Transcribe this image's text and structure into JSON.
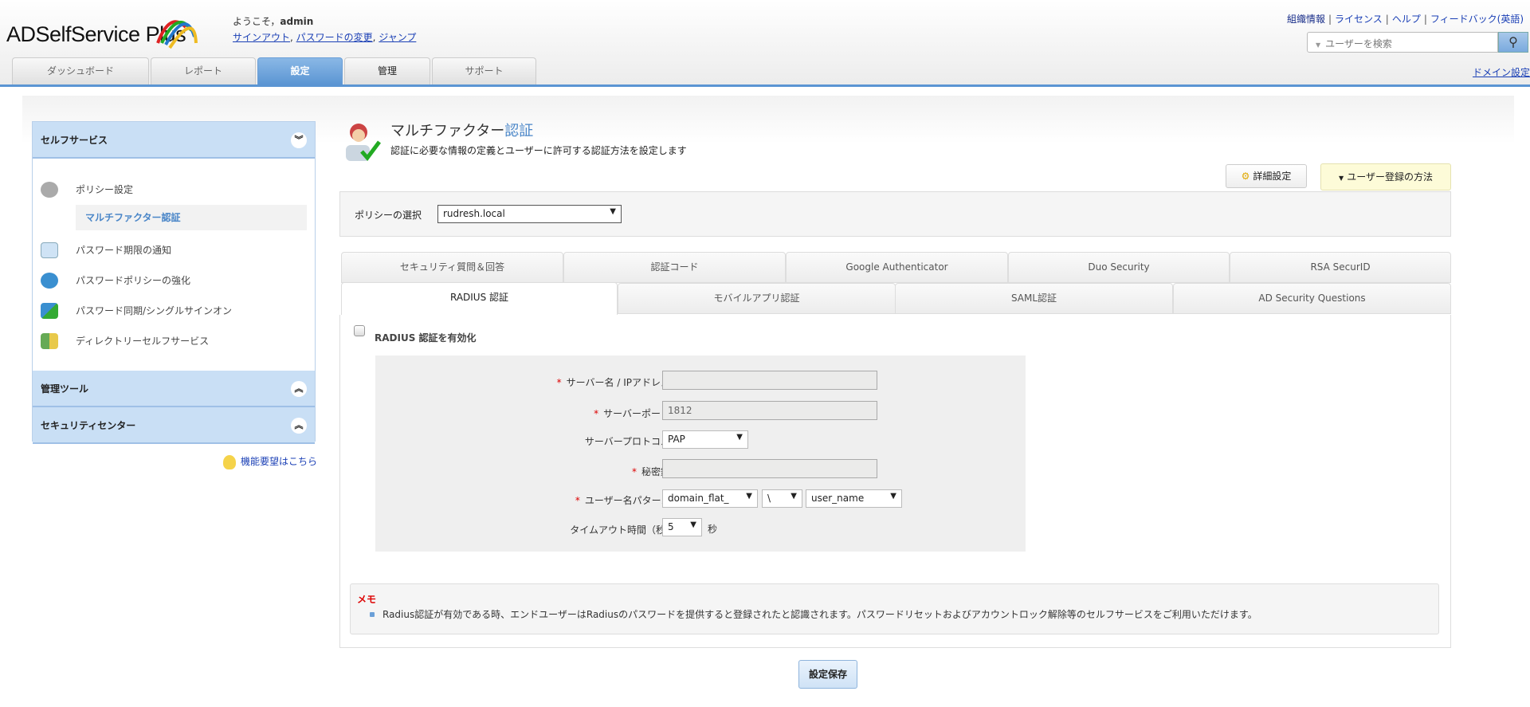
{
  "header": {
    "logo": "ADSelfService Plus",
    "welcome_prefix": "ようこそ，",
    "username": "admin",
    "user_links": [
      "サインアウト",
      "パスワードの変更",
      "ジャンプ"
    ],
    "top_links": [
      "組織情報",
      "ライセンス",
      "ヘルプ",
      "フィードバック(英語)"
    ],
    "search_placeholder": "ユーザーを検索",
    "domain_settings": "ドメイン設定",
    "tabs": [
      {
        "label": "ダッシュボード"
      },
      {
        "label": "レポート"
      },
      {
        "label": "設定",
        "active": true
      },
      {
        "label": "管理"
      },
      {
        "label": "サポート"
      }
    ]
  },
  "sidebar": {
    "sections": [
      {
        "title": "セルフサービス",
        "expanded": true
      },
      {
        "title": "管理ツール"
      },
      {
        "title": "セキュリティセンター"
      }
    ],
    "items": [
      "ポリシー設定",
      "マルチファクター認証",
      "パスワード期限の通知",
      "パスワードポリシーの強化",
      "パスワード同期/シングルサインオン",
      "ディレクトリーセルフサービス"
    ],
    "feature_request": "機能要望はこちら"
  },
  "main": {
    "title_prefix": "マルチファクター",
    "title_suffix": "認証",
    "subtitle": "認証に必要な情報の定義とユーザーに許可する認証方法を設定します",
    "advanced_button": "詳細設定",
    "enroll_button": "ユーザー登録の方法",
    "policy_label": "ポリシーの選択",
    "policy_value": "rudresh.local",
    "tabs_row1": [
      "セキュリティ質問＆回答",
      "認証コード",
      "Google Authenticator",
      "Duo Security",
      "RSA SecurID"
    ],
    "tabs_row2": [
      "RADIUS 認証",
      "モバイルアプリ認証",
      "SAML認証",
      "AD Security Questions"
    ],
    "enable_label": "RADIUS 認証を有効化",
    "form": {
      "server_label": "サーバー名 / IPアドレス：",
      "server_value": "",
      "port_label": "サーバーポート：",
      "port_value": "1812",
      "protocol_label": "サーバープロトコル：",
      "protocol_value": "PAP",
      "secret_label": "秘密鍵：",
      "secret_value": "",
      "pattern_label": "ユーザー名パターン：",
      "pattern_values": [
        "domain_flat_",
        "\\",
        "user_name"
      ],
      "timeout_label": "タイムアウト時間（秒）：",
      "timeout_value": "5",
      "timeout_unit": "秒",
      "required_mark": "*"
    },
    "memo_title": "メモ",
    "memo_text": "Radius認証が有効である時、エンドユーザーはRadiusのパスワードを提供すると登録されたと認識されます。パスワードリセットおよびアカウントロック解除等のセルフサービスをご利用いただけます。",
    "save_button": "設定保存"
  },
  "colors": {
    "accent": "#5b95d3",
    "sidebar_header": "#c9dff5",
    "required": "#dd0000"
  }
}
